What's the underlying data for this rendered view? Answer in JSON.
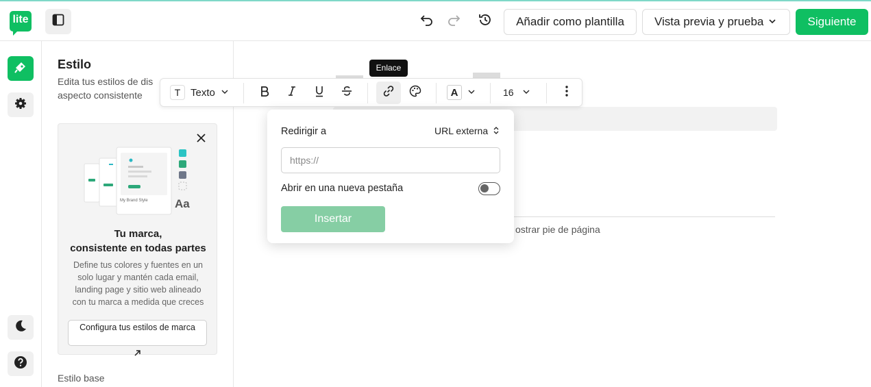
{
  "app": {
    "logo_text": "lite",
    "brand_color": "#0fbf62"
  },
  "header": {
    "add_template_label": "Añadir como plantilla",
    "preview_label": "Vista previa y prueba",
    "next_label": "Siguiente"
  },
  "sidebar": {
    "title": "Estilo",
    "description": "Edita tus estilos de dis aspecto consistente",
    "promo": {
      "title_line1": "Tu marca,",
      "title_line2": "consistente en todas partes",
      "body": "Define tus colores y fuentes en un solo lugar y mantén cada email, landing page y sitio web alineado con tu marca a medida que creces",
      "button_label": "Configura tus estilos de marca",
      "illustration_caption": "My Brand Style",
      "illustration_aa": "Aa"
    },
    "base_style_label": "Estilo base"
  },
  "canvas": {
    "footer_text": "ostrar pie de página"
  },
  "toolbar": {
    "tooltip": "Enlace",
    "text_style": "Texto",
    "text_style_icon": "T",
    "color_icon": "A",
    "font_size": "16"
  },
  "link_popover": {
    "redirect_label": "Redirigir a",
    "redirect_select": "URL externa",
    "url_placeholder": "https://",
    "new_tab_label": "Abrir en una nueva pestaña",
    "new_tab_enabled": false,
    "insert_label": "Insertar"
  }
}
